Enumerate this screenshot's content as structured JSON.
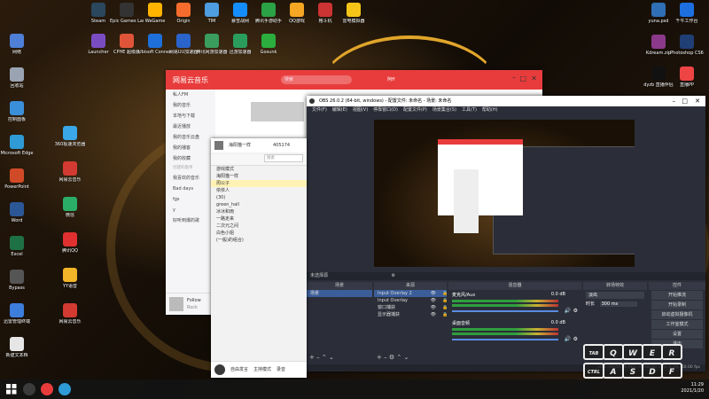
{
  "desktop_left": [
    {
      "label": "网络",
      "color": "#4f7fd6"
    },
    {
      "label": "回收站",
      "color": "#9aa3b2"
    },
    {
      "label": "控制面板",
      "color": "#3a8fd9"
    },
    {
      "label": "Microsoft Edge",
      "color": "#2e9ad6"
    },
    {
      "label": "PowerPoint",
      "color": "#d04a27"
    },
    {
      "label": "Word",
      "color": "#2b5797"
    },
    {
      "label": "Excel",
      "color": "#1e7145"
    },
    {
      "label": "Bypass",
      "color": "#555555"
    },
    {
      "label": "迅雷管理终端",
      "color": "#3d7ddc"
    },
    {
      "label": "新建文本档",
      "color": "#e6e6e6"
    }
  ],
  "desktop_col2": [
    {
      "label": "360极速浏览器",
      "color": "#3aa7e8"
    },
    {
      "label": "网易云音乐",
      "color": "#d33a31"
    },
    {
      "label": "微信",
      "color": "#2aae67"
    },
    {
      "label": "腾讯QQ",
      "color": "#e03030"
    },
    {
      "label": "YY语音",
      "color": "#f2b529"
    },
    {
      "label": "网易云音乐",
      "color": "#d33a31"
    }
  ],
  "desktop_top": [
    {
      "label": "Steam",
      "color": "#2a475e"
    },
    {
      "label": "Epic Games Launcher",
      "color": "#333333"
    },
    {
      "label": "WeGame",
      "color": "#ffb400"
    },
    {
      "label": "Origin",
      "color": "#f56c2d"
    },
    {
      "label": "TIM",
      "color": "#4d9de0"
    },
    {
      "label": "暴雪战网",
      "color": "#148eff"
    },
    {
      "label": "腾讯手游助手",
      "color": "#2ba245"
    },
    {
      "label": "QQ游戏",
      "color": "#f5a623"
    },
    {
      "label": "格斗机",
      "color": "#cc3333"
    },
    {
      "label": "雷电模拟器",
      "color": "#f5c518"
    }
  ],
  "desktop_row2": [
    {
      "label": "Launcher",
      "color": "#7a4cc2"
    },
    {
      "label": "CPHE 超级版",
      "color": "#e0553a"
    },
    {
      "label": "Ubisoft Connect",
      "color": "#1e6fd9"
    },
    {
      "label": "网易UU加速器",
      "color": "#2a63c9"
    },
    {
      "label": "腾讯网游加速器",
      "color": "#3a9d5d"
    },
    {
      "label": "迅游加速器",
      "color": "#2a9d5d"
    },
    {
      "label": "Gosunk",
      "color": "#2cae3f"
    }
  ],
  "desktop_right": [
    {
      "label": "yuna.psd",
      "color": "#2f6fb5"
    },
    {
      "label": "千牛工作台",
      "color": "#1d6fe0"
    },
    {
      "label": "Kdream.zip",
      "color": "#8b3a8b"
    },
    {
      "label": "Photoshop CS6",
      "color": "#1f3f75"
    },
    {
      "label": "dyzb 直播伴侣",
      "color": "#111111"
    },
    {
      "label": "直播PP",
      "color": "#e44"
    }
  ],
  "netease": {
    "logo": "网易云音乐",
    "search_placeholder": "搜索",
    "user": "阿ff",
    "sidebar_items": [
      "私人FM",
      "我的音乐",
      "本地与下载",
      "最近播放",
      "我的音乐云盘",
      "我的播客",
      "我的收藏"
    ],
    "section_created": "创建的歌单",
    "playlists": [
      "我喜欢的音乐",
      "Bad days",
      "fgs",
      "y",
      "好听到爆的歌"
    ],
    "bottom_title": "Follow",
    "bottom_artist": "Rock"
  },
  "obs": {
    "title": "OBS 26.0.2 (64-bit, windows) - 配置文件: 未命名 - 场景: 未命名",
    "menu": [
      "文件(F)",
      "编辑(E)",
      "视图(V)",
      "停靠窗口(D)",
      "配置文件(P)",
      "场景集合(S)",
      "工具(T)",
      "帮助(H)"
    ],
    "scene_bar": "未选择源",
    "dock_scene_title": "场景",
    "scenes": [
      "场景"
    ],
    "dock_source_title": "来源",
    "sources": [
      "Input Overlay 2",
      "Input Overlay",
      "窗口捕获",
      "显示器捕获"
    ],
    "dock_mixer_title": "混音器",
    "mixer": [
      {
        "name": "麦克风/Aux",
        "db": "0.0 dB"
      },
      {
        "name": "桌面音频",
        "db": "0.0 dB"
      }
    ],
    "dock_trans_title": "转场特效",
    "trans_type": "淡出",
    "trans_label": "时长",
    "trans_duration": "300 ms",
    "dock_ctrl_title": "控件",
    "controls": [
      "开始推流",
      "开始录制",
      "启动虚拟摄像机",
      "工作室模式",
      "设置",
      "退出"
    ],
    "status": "LIVE: 00:00:00   REC: 00:00:00   CPU: 2.3%, 60.00 fps"
  },
  "qq": {
    "group_name": "海阳猫一样",
    "member_count": "405174",
    "search_placeholder": "搜索",
    "channels": [
      "游戏模式",
      "海阳猫一样",
      "周公子",
      "依依人",
      "(30)",
      "green_hall",
      "冰冰和雨",
      "一路走来",
      "二次元之间",
      "白色小姐",
      "(一般)的组合)"
    ],
    "footer_tabs": [
      "自由发言",
      "主持模式",
      "录音"
    ]
  },
  "keyboard": [
    "TAB",
    "Q",
    "W",
    "E",
    "R",
    "CTRL",
    "A",
    "S",
    "D",
    "F"
  ],
  "taskbar": {
    "time": "11:29",
    "date": "2021/1/20"
  }
}
